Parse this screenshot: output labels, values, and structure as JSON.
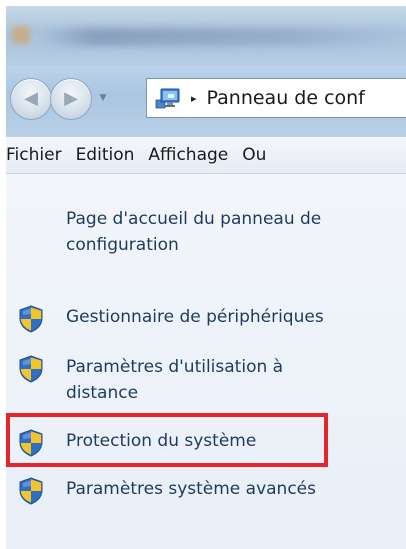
{
  "window": {
    "title_icon": "control-panel-icon",
    "title_blurred": true
  },
  "navigation": {
    "back_icon": "arrow-left-icon",
    "forward_icon": "arrow-right-icon",
    "history_icon": "chevron-down-icon",
    "address_icon": "control-panel-icon",
    "breadcrumb_separator": "▸",
    "breadcrumb_text": "Panneau de conf"
  },
  "menubar": {
    "items": [
      {
        "label": "Fichier"
      },
      {
        "label": "Edition"
      },
      {
        "label": "Affichage"
      },
      {
        "label": "Ou"
      }
    ]
  },
  "taskpane": {
    "home_link": "Page d'accueil du panneau de configuration",
    "tasks": [
      {
        "label": "Gestionnaire de périphériques",
        "icon": "uac-shield-icon"
      },
      {
        "label": "Paramètres d'utilisation à distance",
        "icon": "uac-shield-icon"
      },
      {
        "label": "Protection du système",
        "icon": "uac-shield-icon",
        "highlighted": true
      },
      {
        "label": "Paramètres système avancés",
        "icon": "uac-shield-icon"
      }
    ]
  },
  "colors": {
    "link": "#1e3a5f",
    "highlight": "#e3262d",
    "pane_background": "#eef3f9",
    "shield_blue": "#2f6fc4",
    "shield_yellow": "#f4c52b"
  }
}
